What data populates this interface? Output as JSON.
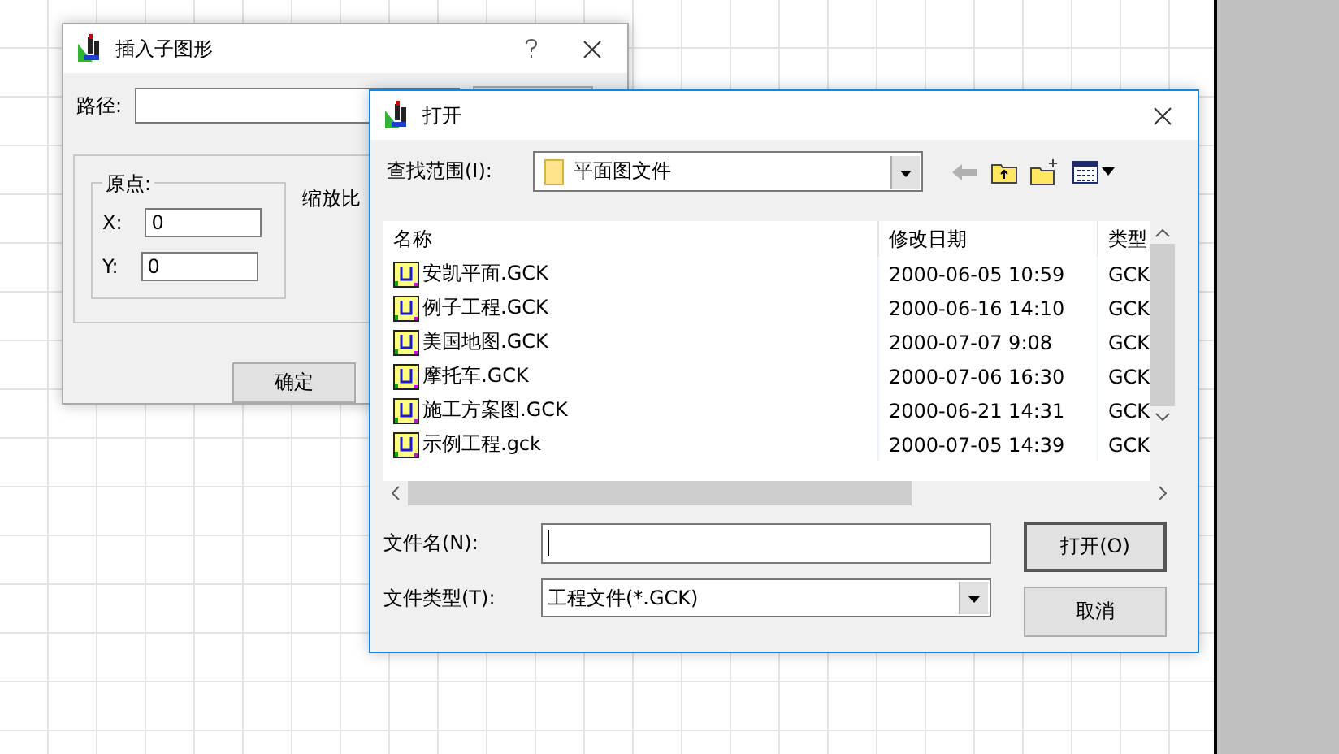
{
  "back_dialog": {
    "title": "插入子图形",
    "path_label": "路径:",
    "origin_group": "原点:",
    "x_label": "X:",
    "x_value": "0",
    "y_label": "Y:",
    "y_value": "0",
    "scale_label": "缩放比",
    "ok_button": "确定"
  },
  "open_dialog": {
    "title": "打开",
    "look_in_label": "查找范围(I):",
    "look_in_value": "平面图文件",
    "columns": [
      "名称",
      "修改日期",
      "类型"
    ],
    "rows": [
      {
        "name": "安凯平面.GCK",
        "modified": "2000-06-05 10:59",
        "type": "GCK"
      },
      {
        "name": "例子工程.GCK",
        "modified": "2000-06-16 14:10",
        "type": "GCK"
      },
      {
        "name": "美国地图.GCK",
        "modified": "2000-07-07 9:08",
        "type": "GCK"
      },
      {
        "name": "摩托车.GCK",
        "modified": "2000-07-06 16:30",
        "type": "GCK"
      },
      {
        "name": "施工方案图.GCK",
        "modified": "2000-06-21 14:31",
        "type": "GCK"
      },
      {
        "name": "示例工程.gck",
        "modified": "2000-07-05 14:39",
        "type": "GCK"
      }
    ],
    "filename_label": "文件名(N):",
    "filetype_label": "文件类型(T):",
    "filetype_value": "工程文件(*.GCK)",
    "open_button": "打开(O)",
    "cancel_button": "取消"
  }
}
